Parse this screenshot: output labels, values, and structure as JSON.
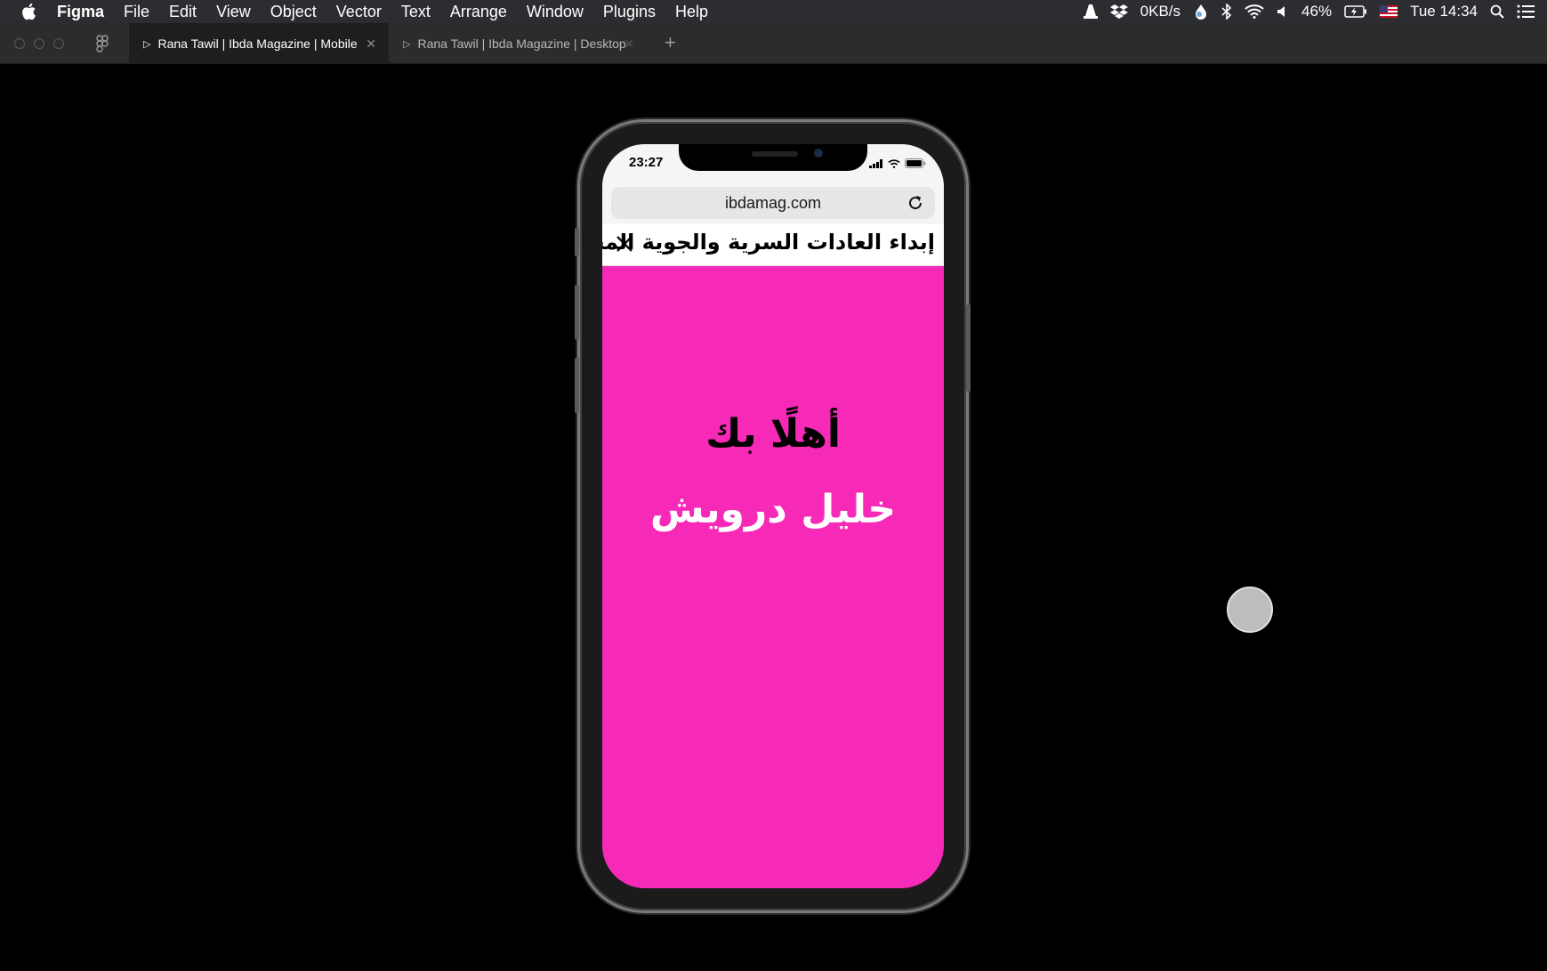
{
  "menubar": {
    "app_name": "Figma",
    "items": [
      "File",
      "Edit",
      "View",
      "Object",
      "Vector",
      "Text",
      "Arrange",
      "Window",
      "Plugins",
      "Help"
    ],
    "net_speed": "0KB/s",
    "battery": "46%",
    "clock": "Tue 14:34"
  },
  "tabs": [
    {
      "label": "Rana Tawil | Ibda Magazine | Mobile",
      "active": true
    },
    {
      "label": "Rana Tawil | Ibda Magazine | Desktop",
      "active": false
    }
  ],
  "phone": {
    "time": "23:27",
    "url": "ibdamag.com",
    "header_title": "إبداء العادات السرية والجوية المخفية",
    "welcome": "أهلًا بك",
    "name": "خليل درويش",
    "background_color": "#f72ab8"
  }
}
